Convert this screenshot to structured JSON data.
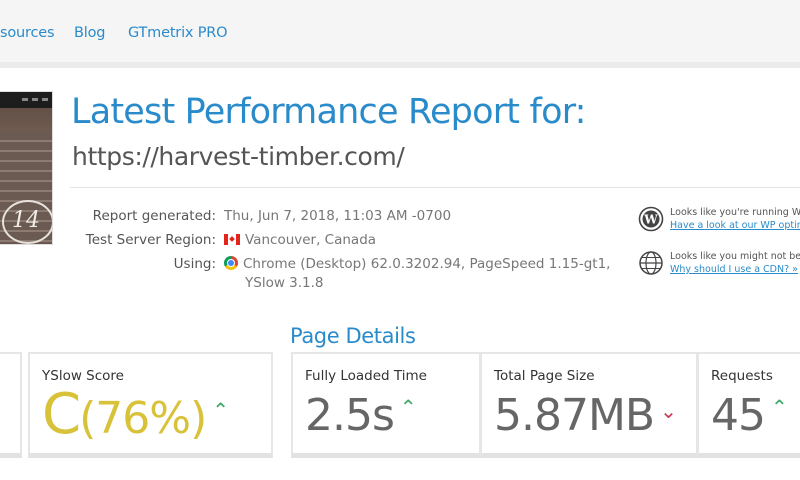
{
  "nav": {
    "items": [
      {
        "label": "sources"
      },
      {
        "label": "Blog"
      },
      {
        "label": "GTmetrix PRO"
      }
    ]
  },
  "header": {
    "title": "Latest Performance Report for:",
    "url": "https://harvest-timber.com/",
    "thumbnail_caption": "14"
  },
  "meta": {
    "report_generated_label": "Report generated:",
    "report_generated_value": "Thu, Jun 7, 2018, 11:03 AM -0700",
    "region_label": "Test Server Region:",
    "region_value": "Vancouver, Canada",
    "using_label": "Using:",
    "using_value_line1": "Chrome (Desktop) 62.0.3202.94, PageSpeed 1.15-gt1,",
    "using_value_line2": "YSlow 3.1.8"
  },
  "side_notices": [
    {
      "icon": "wordpress-icon",
      "text": "Looks like you're running Wor",
      "link": "Have a look at our WP optimiz"
    },
    {
      "icon": "globe-icon",
      "text": "Looks like you might not be u",
      "link": "Why should I use a CDN? »"
    }
  ],
  "page_details": {
    "title": "Page Details",
    "yslow_label": "YSlow Score",
    "yslow_grade": "C",
    "yslow_pct": "(76%)",
    "fully_loaded_label": "Fully Loaded Time",
    "fully_loaded_value": "2.5s",
    "page_size_label": "Total Page Size",
    "page_size_value": "5.87MB",
    "requests_label": "Requests",
    "requests_value": "45",
    "arrow_up": "⌃",
    "arrow_down": "⌄"
  },
  "colors": {
    "accent": "#2a8bcb",
    "grade_c": "#d8c23a",
    "good": "#3ca868",
    "bad": "#cc3355"
  }
}
